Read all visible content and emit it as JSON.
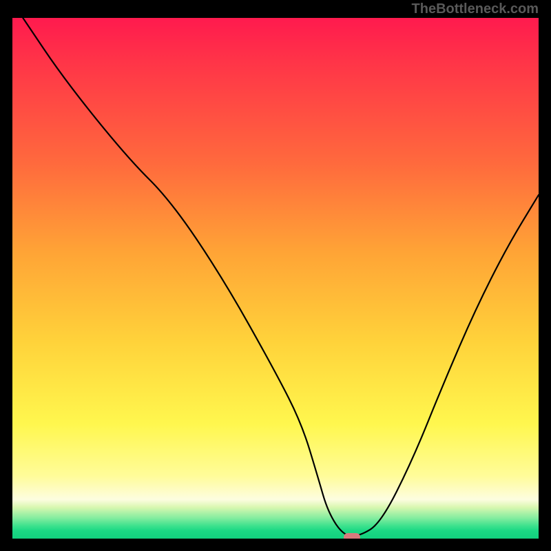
{
  "watermark": "TheBottleneck.com",
  "chart_data": {
    "type": "line",
    "title": "",
    "xlabel": "",
    "ylabel": "",
    "xlim": [
      0,
      100
    ],
    "ylim": [
      0,
      100
    ],
    "series": [
      {
        "name": "bottleneck-curve",
        "x": [
          2,
          10,
          22,
          30,
          40,
          50,
          55,
          58,
          60,
          63,
          66,
          70,
          76,
          82,
          88,
          94,
          100
        ],
        "y": [
          100,
          88,
          73,
          65,
          50,
          32,
          22,
          12,
          5,
          0.5,
          0.5,
          3,
          15,
          30,
          44,
          56,
          66
        ]
      }
    ],
    "marker": {
      "x": 64.5,
      "y": 0.3
    },
    "gradient_stops": [
      {
        "pos": 0,
        "color": "#ff1a4e"
      },
      {
        "pos": 28,
        "color": "#ff6a3d"
      },
      {
        "pos": 62,
        "color": "#ffd23a"
      },
      {
        "pos": 88,
        "color": "#fffc9a"
      },
      {
        "pos": 100,
        "color": "#12d07e"
      }
    ]
  }
}
